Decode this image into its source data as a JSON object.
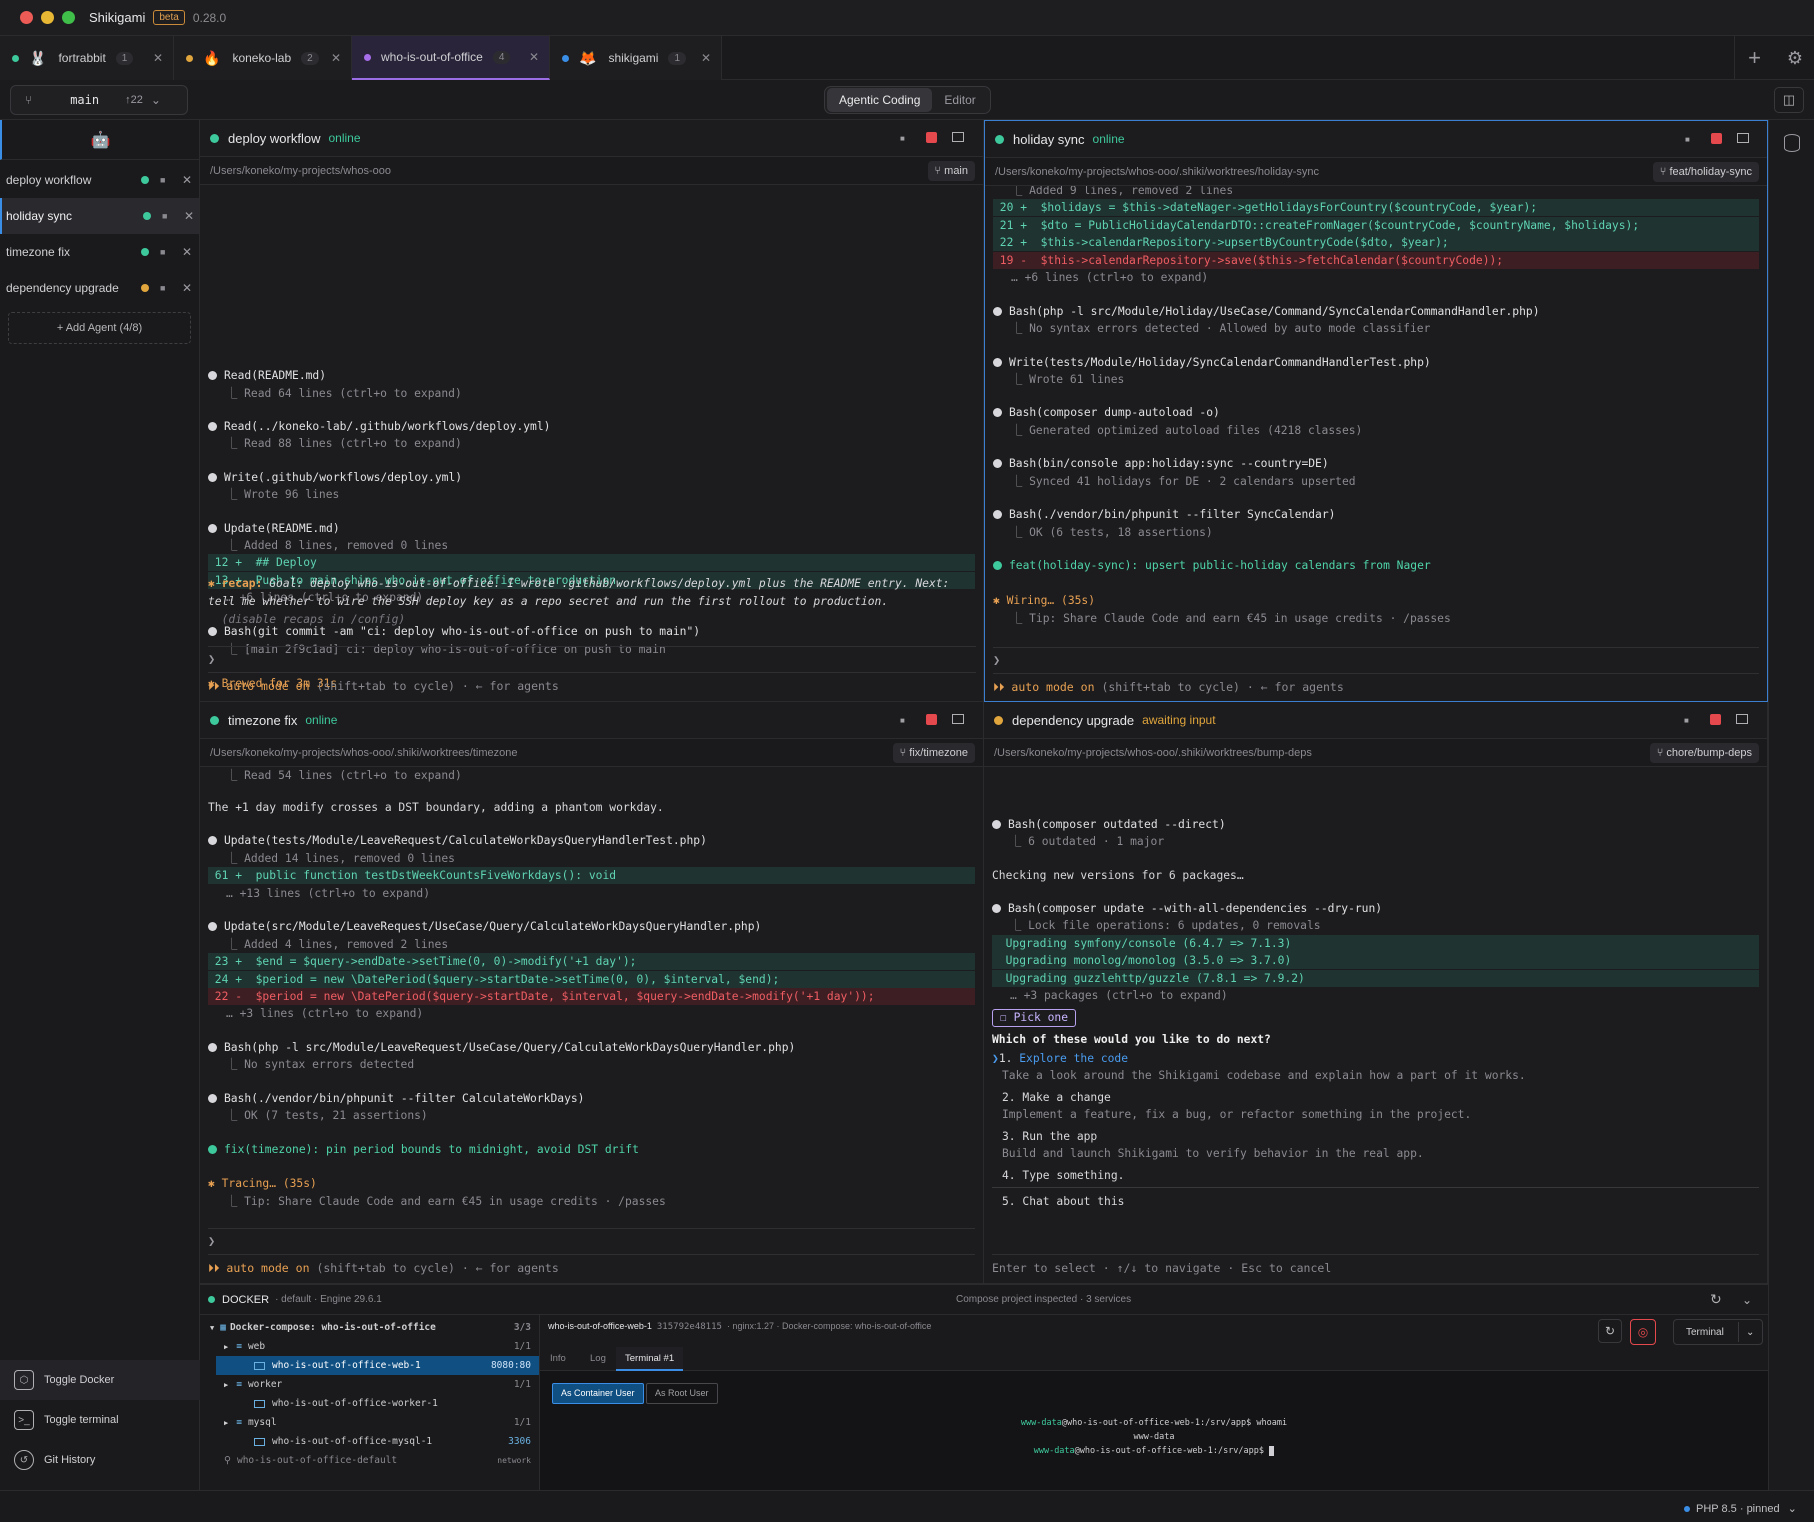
{
  "app": {
    "title": "Shikigami",
    "badge": "beta",
    "version": "0.28.0"
  },
  "project_tabs": [
    {
      "name": "fortrabbit",
      "count": "1",
      "dot": "#3ec99c",
      "emoji": "🐰"
    },
    {
      "name": "koneko-lab",
      "count": "2",
      "dot": "#e0a53c",
      "emoji": "🔥"
    },
    {
      "name": "who-is-out-of-office",
      "count": "4",
      "dot": "#a66ee8",
      "emoji": ""
    },
    {
      "name": "shikigami",
      "count": "1",
      "dot": "#3a8ee6",
      "emoji": "🦊"
    }
  ],
  "toolbar": {
    "branch": "main",
    "ahead": "↑22",
    "modes": [
      "Agentic Coding",
      "Editor"
    ]
  },
  "sidebar": {
    "agents": [
      {
        "name": "deploy workflow",
        "status_color": "#3ec99c"
      },
      {
        "name": "holiday sync",
        "status_color": "#3ec99c"
      },
      {
        "name": "timezone fix",
        "status_color": "#3ec99c"
      },
      {
        "name": "dependency upgrade",
        "status_color": "#e0a53c"
      }
    ],
    "add_label": "+ Add Agent (4/8)",
    "actions": [
      "Toggle Docker",
      "Toggle terminal",
      "Git History"
    ]
  },
  "panes": {
    "deploy": {
      "title": "deploy workflow",
      "status": "online",
      "path": "/Users/koneko/my-projects/whos-ooo",
      "branch": "main",
      "l01": "Read(README.md)",
      "l02": "⎿ Read 64 lines (ctrl+o to expand)",
      "l03": "Read(../koneko-lab/.github/workflows/deploy.yml)",
      "l04": "⎿ Read 88 lines (ctrl+o to expand)",
      "l05": "Write(.github/workflows/deploy.yml)",
      "l06": "⎿ Wrote 96 lines",
      "l07": "Update(README.md)",
      "l08": "⎿ Added 8 lines, removed 0 lines",
      "l09": " 12 +  ## Deploy",
      "l10": " 13 +  Push to main ships who-is-out-of-office to production.",
      "l11": "… +6 lines (ctrl+o to expand)",
      "l12": "Bash(git commit -am \"ci: deploy who-is-out-of-office on push to main\")",
      "l13": "⎿ [main 2f9c1ad] ci: deploy who-is-out-of-office on push to main",
      "l14": "✱ Brewed for 3m 31s",
      "l15a": "✱ recap:",
      "l15b": " Goal: deploy who-is-out-of-office. I wrote .github/workflows/deploy.yml plus the README entry. Next:",
      "l16": "tell me whether to wire the SSH deploy key as a repo secret and run the first rollout to production.",
      "l17": "  (disable recaps in /config)"
    },
    "holiday": {
      "title": "holiday sync",
      "status": "online",
      "path": "/Users/koneko/my-projects/whos-ooo/.shiki/worktrees/holiday-sync",
      "branch": "feat/holiday-sync",
      "l01": "⎿ Added 9 lines, removed 2 lines",
      "l02": " 20 +  $holidays = $this->dateNager->getHolidaysForCountry($countryCode, $year);",
      "l03": " 21 +  $dto = PublicHolidayCalendarDTO::createFromNager($countryCode, $countryName, $holidays);",
      "l04": " 22 +  $this->calendarRepository->upsertByCountryCode($dto, $year);",
      "l05": " 19 -  $this->calendarRepository->save($this->fetchCalendar($countryCode));",
      "l06": "… +6 lines (ctrl+o to expand)",
      "l07": "Bash(php -l src/Module/Holiday/UseCase/Command/SyncCalendarCommandHandler.php)",
      "l08": "⎿ No syntax errors detected · Allowed by auto mode classifier",
      "l09": "Write(tests/Module/Holiday/SyncCalendarCommandHandlerTest.php)",
      "l10": "⎿ Wrote 61 lines",
      "l11": "Bash(composer dump-autoload -o)",
      "l12": "⎿ Generated optimized autoload files (4218 classes)",
      "l13": "Bash(bin/console app:holiday:sync --country=DE)",
      "l14": "⎿ Synced 41 holidays for DE · 2 calendars upserted",
      "l15": "Bash(./vendor/bin/phpunit --filter SyncCalendar)",
      "l16": "⎿ OK (6 tests, 18 assertions)",
      "l17": "feat(holiday-sync): upsert public-holiday calendars from Nager",
      "l18": "✱ Wiring… (35s)",
      "l19": "⎿ Tip: Share Claude Code and earn €45 in usage credits · /passes"
    },
    "timezone": {
      "title": "timezone fix",
      "status": "online",
      "path": "/Users/koneko/my-projects/whos-ooo/.shiki/worktrees/timezone",
      "branch": "fix/timezone",
      "l01": "⎿ Read 54 lines (ctrl+o to expand)",
      "l02": "The +1 day modify crosses a DST boundary, adding a phantom workday.",
      "l03": "Update(tests/Module/LeaveRequest/CalculateWorkDaysQueryHandlerTest.php)",
      "l04": "⎿ Added 14 lines, removed 0 lines",
      "l05": " 61 +  public function testDstWeekCountsFiveWorkdays(): void",
      "l06": "… +13 lines (ctrl+o to expand)",
      "l07": "Update(src/Module/LeaveRequest/UseCase/Query/CalculateWorkDaysQueryHandler.php)",
      "l08": "⎿ Added 4 lines, removed 2 lines",
      "l09": " 23 +  $end = $query->endDate->setTime(0, 0)->modify('+1 day');",
      "l10": " 24 +  $period = new \\DatePeriod($query->startDate->setTime(0, 0), $interval, $end);",
      "l11": " 22 -  $period = new \\DatePeriod($query->startDate, $interval, $query->endDate->modify('+1 day'));",
      "l12": "… +3 lines (ctrl+o to expand)",
      "l13": "Bash(php -l src/Module/LeaveRequest/UseCase/Query/CalculateWorkDaysQueryHandler.php)",
      "l14": "⎿ No syntax errors detected",
      "l15": "Bash(./vendor/bin/phpunit --filter CalculateWorkDays)",
      "l16": "⎿ OK (7 tests, 21 assertions)",
      "l17": "fix(timezone): pin period bounds to midnight, avoid DST drift",
      "l18": "✱ Tracing… (35s)",
      "l19": "⎿ Tip: Share Claude Code and earn €45 in usage credits · /passes"
    },
    "deps": {
      "title": "dependency upgrade",
      "status": "awaiting input",
      "path": "/Users/koneko/my-projects/whos-ooo/.shiki/worktrees/bump-deps",
      "branch": "chore/bump-deps",
      "l01": "Bash(composer outdated --direct)",
      "l02": "⎿ 6 outdated · 1 major",
      "l03": "Checking new versions for 6 packages…",
      "l04": "Bash(composer update --with-all-dependencies --dry-run)",
      "l05": "⎿ Lock file operations: 6 updates, 0 removals",
      "l06": "  Upgrading symfony/console (6.4.7 => 7.1.3)",
      "l07": "  Upgrading monolog/monolog (3.5.0 => 3.7.0)",
      "l08": "  Upgrading guzzlehttp/guzzle (7.8.1 => 7.9.2)",
      "l09": "… +3 packages (ctrl+o to expand)",
      "pick": "☐ Pick one",
      "question": "Which of these would you like to do next?",
      "o1": "1. ",
      "o1b": "Explore the code",
      "o1d": "Take a look around the Shikigami codebase and explain how a part of it works.",
      "o2": "2. Make a change",
      "o2d": "Implement a feature, fix a bug, or refactor something in the project.",
      "o3": "3. Run the app",
      "o3d": "Build and launch Shikigami to verify behavior in the real app.",
      "o4": "4. Type something.",
      "o5": "5. Chat about this",
      "hint": "Enter to select · ↑/↓ to navigate · Esc to cancel"
    },
    "prompt_char": "❯",
    "footer_am": "⏵⏵ auto mode on",
    "footer_rest": " (shift+tab to cycle) · ← for agents"
  },
  "docker": {
    "title": "DOCKER",
    "context": "· default · Engine 29.6.1",
    "center": "Compose project inspected · 3 services",
    "tree": [
      {
        "label": "Docker-compose: who-is-out-of-office",
        "count": "3/3"
      },
      {
        "label": "web",
        "count": "1/1"
      },
      {
        "label": "who-is-out-of-office-web-1",
        "count": "8080:80"
      },
      {
        "label": "worker",
        "count": "1/1"
      },
      {
        "label": "who-is-out-of-office-worker-1",
        "count": ""
      },
      {
        "label": "mysql",
        "count": "1/1"
      },
      {
        "label": "who-is-out-of-office-mysql-1",
        "count": "3306"
      },
      {
        "label": "who-is-out-of-office-default",
        "count": "network"
      }
    ],
    "container": "who-is-out-of-office-web-1",
    "cid": "315792e48115",
    "meta": "· nginx:1.27 · Docker-compose: who-is-out-of-office",
    "tabs": [
      "Info",
      "Log",
      "Terminal #1"
    ],
    "user_btns": [
      "As Container User",
      "As Root User"
    ],
    "term_btn": "Terminal",
    "term": {
      "user": "www-data",
      "host_path": "@who-is-out-of-office-web-1:/srv/app$",
      "cmd": " whoami",
      "out": "www-data"
    }
  },
  "status": {
    "php": "PHP 8.5",
    "pinned": "· pinned"
  }
}
